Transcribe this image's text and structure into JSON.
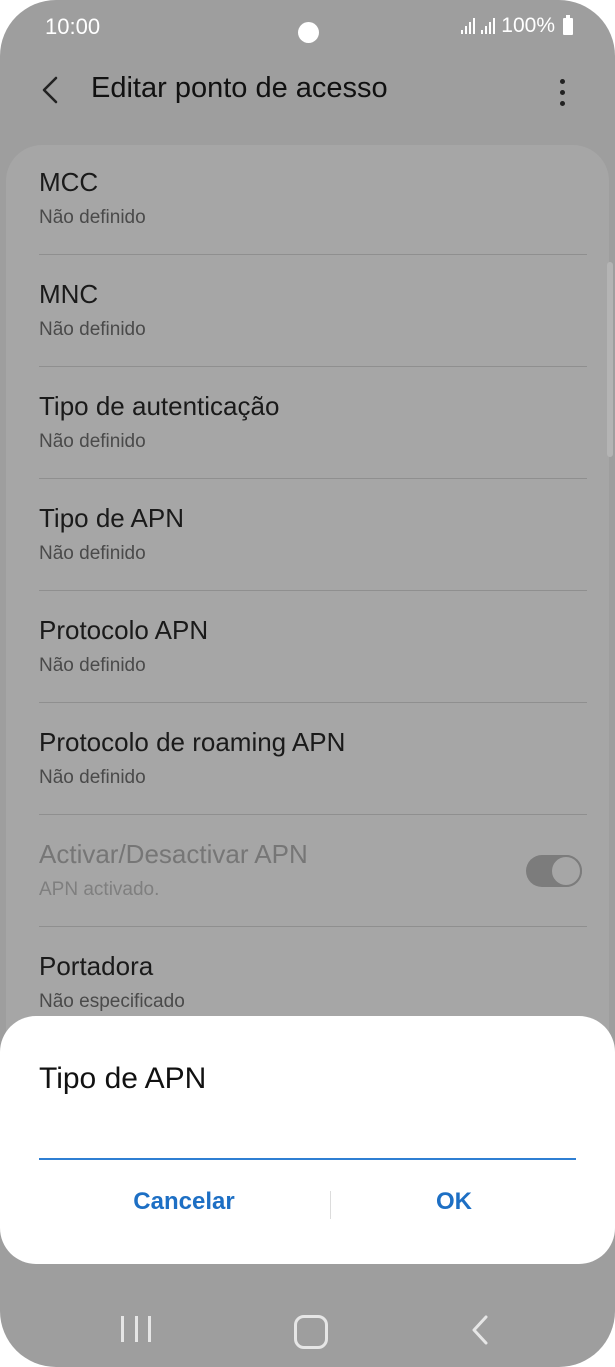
{
  "status_bar": {
    "time": "10:00",
    "battery": "100%"
  },
  "app_bar": {
    "title": "Editar ponto de acesso"
  },
  "settings": [
    {
      "title": "MCC",
      "subtitle": "Não definido"
    },
    {
      "title": "MNC",
      "subtitle": "Não definido"
    },
    {
      "title": "Tipo de autenticação",
      "subtitle": "Não definido"
    },
    {
      "title": "Tipo de APN",
      "subtitle": "Não definido"
    },
    {
      "title": "Protocolo APN",
      "subtitle": "Não definido"
    },
    {
      "title": "Protocolo de roaming APN",
      "subtitle": "Não definido"
    },
    {
      "title": "Activar/Desactivar APN",
      "subtitle": "APN activado.",
      "toggle_on": true,
      "disabled": true
    },
    {
      "title": "Portadora",
      "subtitle": "Não especificado"
    }
  ],
  "dialog": {
    "title": "Tipo de APN",
    "input_value": "",
    "cancel_label": "Cancelar",
    "ok_label": "OK"
  },
  "colors": {
    "accent": "#1d6fc4",
    "input_underline": "#2f7fd3",
    "scrim_background": "#9e9e9e"
  },
  "icons": {
    "back": "back-arrow-icon",
    "more": "more-options-icon",
    "nav_recent": "recent-apps-icon",
    "nav_home": "home-icon",
    "nav_back": "nav-back-icon"
  }
}
